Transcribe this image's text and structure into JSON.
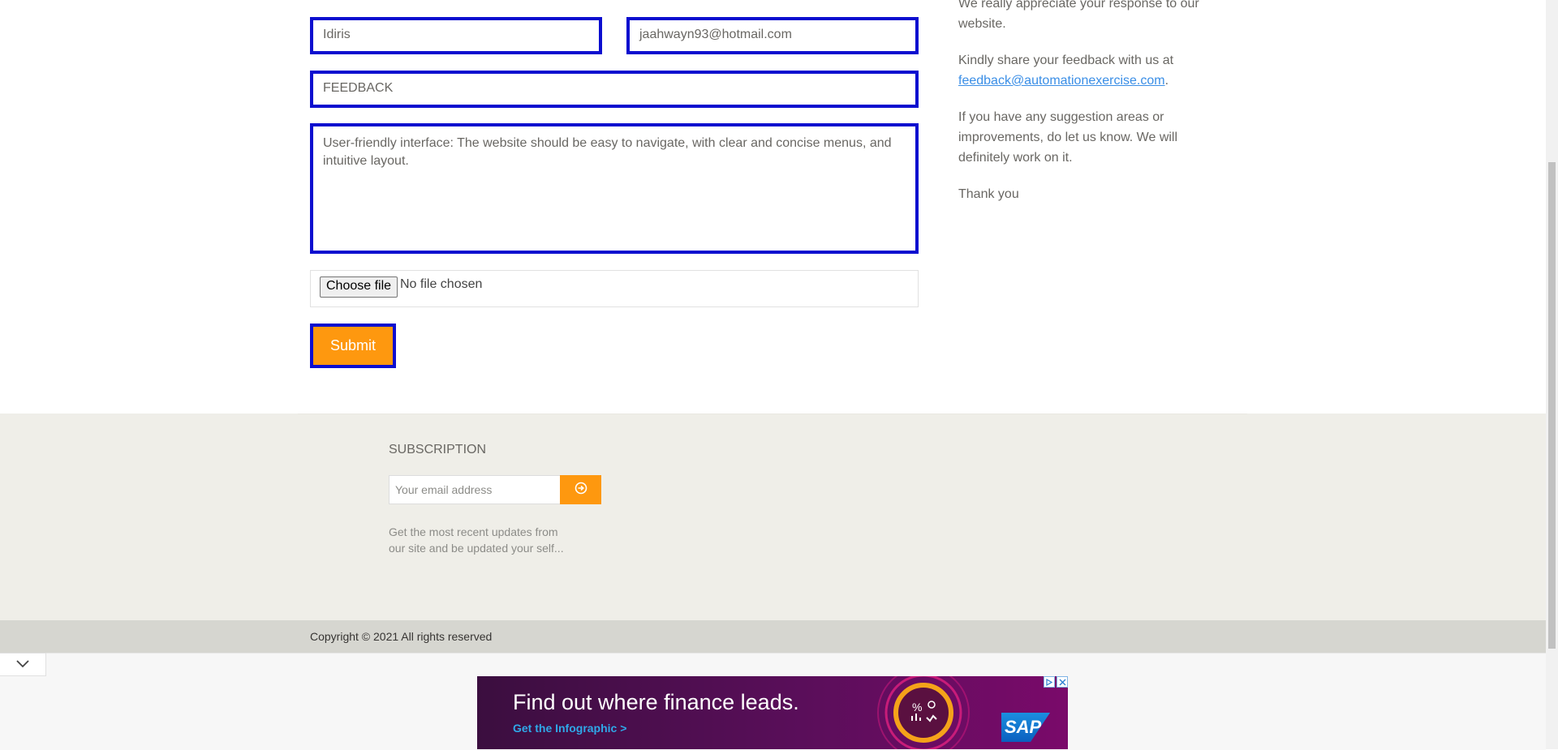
{
  "form": {
    "name_value": "Idiris",
    "email_value": "jaahwayn93@hotmail.com",
    "subject_value": "FEEDBACK",
    "message_value": "User-friendly interface: The website should be easy to navigate, with clear and concise menus, and intuitive layout.",
    "file_button_label": "Choose file",
    "file_status": "No file chosen",
    "submit_label": "Submit"
  },
  "info": {
    "line1": "We really appreciate your response to our website.",
    "line2_prefix": "Kindly share your feedback with us at ",
    "feedback_email": "feedback@automationexercise.com",
    "line2_suffix": ".",
    "line3": "If you have any suggestion areas or improvements, do let us know. We will definitely work on it.",
    "line4": "Thank you"
  },
  "footer": {
    "subscription_title": "SUBSCRIPTION",
    "email_placeholder": "Your email address",
    "subscribe_description": "Get the most recent updates from our site and be updated your self...",
    "copyright": "Copyright © 2021 All rights reserved"
  },
  "ad": {
    "headline": "Find out where finance leads.",
    "cta": "Get the Infographic >",
    "brand": "SAP"
  },
  "icons": {
    "subscribe": "arrow-circle-right-icon",
    "collapse": "chevron-down-icon",
    "ad_choices": "ad-choices-icon",
    "ad_close": "close-icon"
  },
  "colors": {
    "accent": "#FE980F",
    "focus_border": "#0C0ECF",
    "link": "#3A8EE6"
  }
}
